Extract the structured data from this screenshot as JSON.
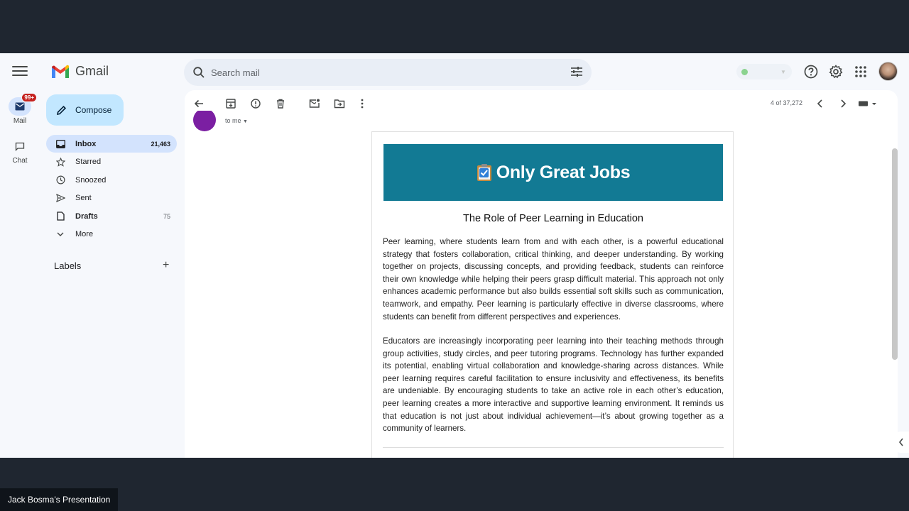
{
  "app": {
    "name": "Gmail"
  },
  "rail": {
    "mail": {
      "label": "Mail",
      "badge": "99+"
    },
    "chat": {
      "label": "Chat"
    }
  },
  "search": {
    "placeholder": "Search mail"
  },
  "compose": {
    "label": "Compose"
  },
  "nav": {
    "items": [
      {
        "label": "Inbox",
        "count": "21,463",
        "icon": "inbox-icon"
      },
      {
        "label": "Starred",
        "count": "",
        "icon": "star-icon"
      },
      {
        "label": "Snoozed",
        "count": "",
        "icon": "clock-icon"
      },
      {
        "label": "Sent",
        "count": "",
        "icon": "send-icon"
      },
      {
        "label": "Drafts",
        "count": "75",
        "icon": "draft-icon"
      },
      {
        "label": "More",
        "count": "",
        "icon": "chevron-down-icon"
      }
    ],
    "labels_heading": "Labels",
    "labels_add": "+"
  },
  "toolbar": {
    "pagecount": "4 of 37,272"
  },
  "email": {
    "recipient_line": "to me",
    "banner_text": "Only Great Jobs",
    "title": "The Role of Peer Learning in Education",
    "paragraphs": [
      "Peer learning, where students learn from and with each other, is a powerful educational strategy that fosters collaboration, critical thinking, and deeper understanding. By working together on projects, discussing concepts, and providing feedback, students can reinforce their own knowledge while helping their peers grasp difficult material. This approach not only enhances academic performance but also builds essential soft skills such as communication, teamwork, and empathy. Peer learning is particularly effective in diverse classrooms, where students can benefit from different perspectives and experiences.",
      "Educators are increasingly incorporating peer learning into their teaching methods through group activities, study circles, and peer tutoring programs. Technology has further expanded its potential, enabling virtual collaboration and knowledge-sharing across distances. While peer learning requires careful facilitation to ensure inclusivity and effectiveness, its benefits are undeniable. By encouraging students to take an active role in each other’s education, peer learning creates a more interactive and supportive learning environment. It reminds us that education is not just about individual achievement—it’s about growing together as a community of learners."
    ]
  },
  "presenter": {
    "label": "Jack Bosma's Presentation"
  },
  "colors": {
    "accent": "#c2e7ff",
    "active_nav": "#d3e3fd",
    "banner": "#127a94"
  }
}
